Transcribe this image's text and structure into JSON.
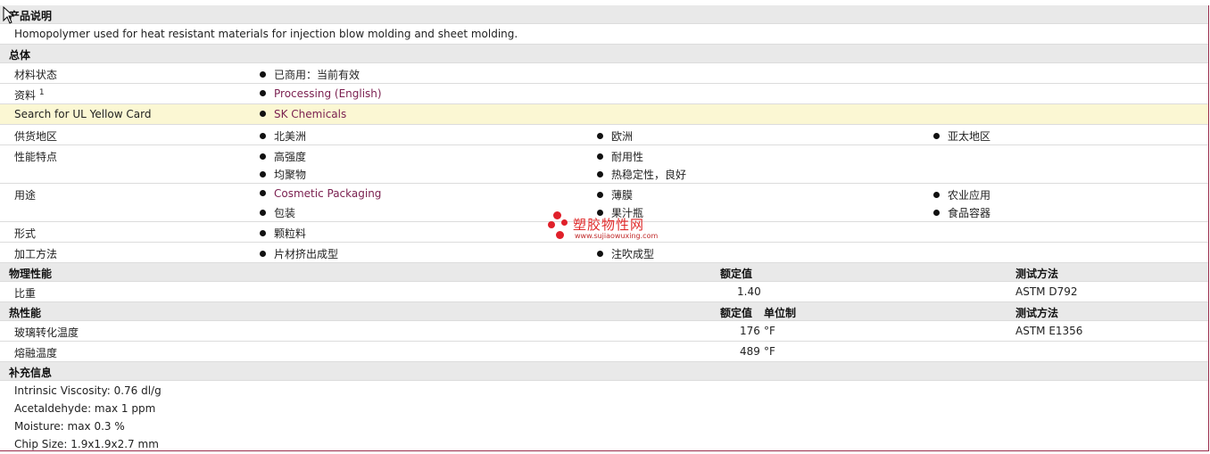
{
  "sections": {
    "description": {
      "title": "产品说明",
      "text": "Homopolymer used for heat resistant materials for injection blow molding and sheet molding."
    },
    "general": {
      "title": "总体",
      "material_status": {
        "label": "材料状态",
        "value": "已商用：当前有效"
      },
      "documents": {
        "label": "资料",
        "footnote": "1",
        "value": "Processing (English)"
      },
      "ul": {
        "label": "Search for UL Yellow Card",
        "value": "SK Chemicals"
      },
      "availability": {
        "label": "供货地区",
        "values": [
          "北美洲",
          "欧洲",
          "亚太地区"
        ]
      },
      "features": {
        "label": "性能特点",
        "values": [
          "高强度",
          "耐用性",
          "均聚物",
          "热稳定性，良好"
        ]
      },
      "uses": {
        "label": "用途",
        "values": [
          "Cosmetic Packaging",
          "薄膜",
          "农业应用",
          "包装",
          "果汁瓶",
          "食品容器"
        ]
      },
      "forms": {
        "label": "形式",
        "value": "颗粒料"
      },
      "processing": {
        "label": "加工方法",
        "values": [
          "片材挤出成型",
          "注吹成型"
        ]
      }
    },
    "physical": {
      "title": "物理性能",
      "nominal_header": "额定值",
      "test_header": "测试方法",
      "rows": [
        {
          "name": "比重",
          "value": "1.40",
          "test": "ASTM D792"
        }
      ]
    },
    "thermal": {
      "title": "热性能",
      "nominal_header": "额定值",
      "unit_header": "单位制",
      "test_header": "测试方法",
      "rows": [
        {
          "name": "玻璃转化温度",
          "value": "176",
          "unit": "°F",
          "test": "ASTM E1356"
        },
        {
          "name": "熔融温度",
          "value": "489",
          "unit": "°F",
          "test": ""
        }
      ]
    },
    "additional": {
      "title": "补充信息",
      "lines": [
        "Intrinsic Viscosity: 0.76 dl/g",
        "Acetaldehyde: max 1 ppm",
        "Moisture: max 0.3 %",
        "Chip Size: 1.9x1.9x2.7 mm"
      ]
    }
  },
  "watermark": {
    "text": "塑胶物性网",
    "url": "www.sujiaowuxing.com",
    "color": "#e0202a"
  }
}
